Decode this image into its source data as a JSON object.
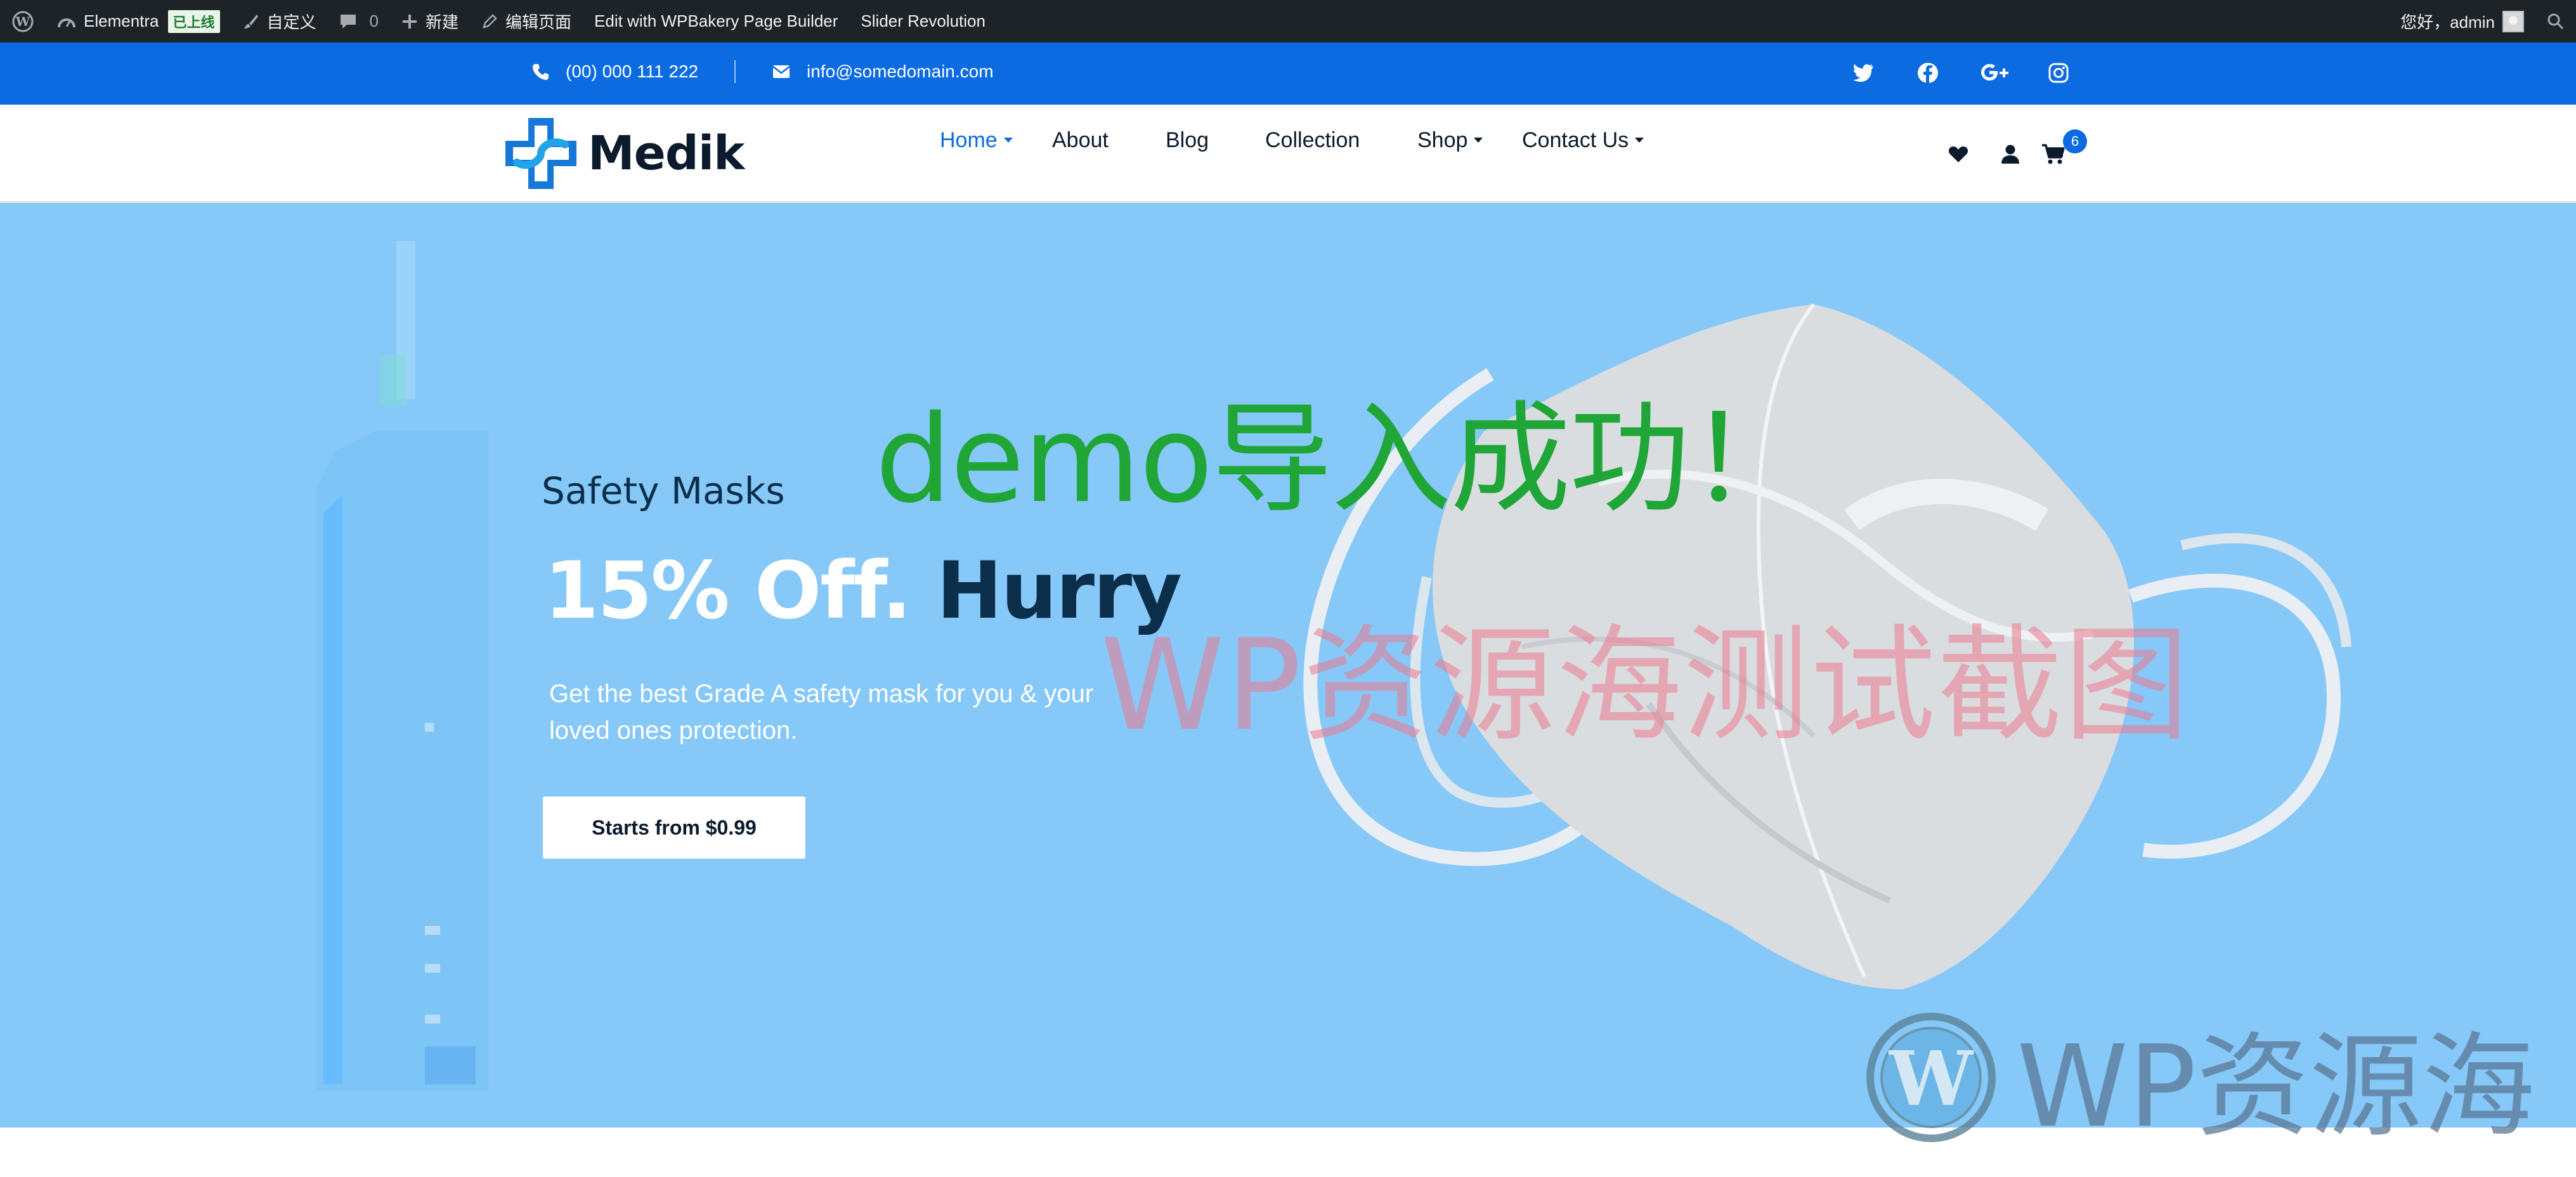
{
  "admin_bar": {
    "site_name": "Elementra",
    "site_status_badge": "已上线",
    "customize_label": "自定义",
    "comments_count": "0",
    "new_label": "新建",
    "edit_page_label": "编辑页面",
    "wpbakery_label": "Edit with WPBakery Page Builder",
    "slider_label": "Slider Revolution",
    "greeting": "您好，admin"
  },
  "contact_bar": {
    "phone": "(00) 000 111 222",
    "email": "info@somedomain.com",
    "social_icons": [
      "twitter-icon",
      "facebook-icon",
      "google-plus-icon",
      "instagram-icon"
    ]
  },
  "header": {
    "logo_text": "Medik",
    "nav": [
      {
        "label": "Home",
        "active": true
      },
      {
        "label": "About"
      },
      {
        "label": "Blog"
      },
      {
        "label": "Collection"
      },
      {
        "label": "Shop"
      },
      {
        "label": "Contact Us"
      }
    ],
    "cart_count": "6"
  },
  "hero": {
    "kicker": "Safety Masks",
    "title_white": "15% Off. ",
    "title_dark": "Hurry",
    "description": "Get the best Grade A safety mask for you & your loved ones protection.",
    "button_label": "Starts from $0.99"
  },
  "overlays": {
    "demo_text": "demo导入成功！",
    "watermark_text": "WP资源海测试截图",
    "corner_logo_text": "WP资源海"
  },
  "colors": {
    "admin_bar": "#1d2327",
    "primary_blue": "#0c6be0",
    "hero_bg": "#86c8f8",
    "dark_navy": "#0b2e4a",
    "demo_green": "#1fa637"
  }
}
